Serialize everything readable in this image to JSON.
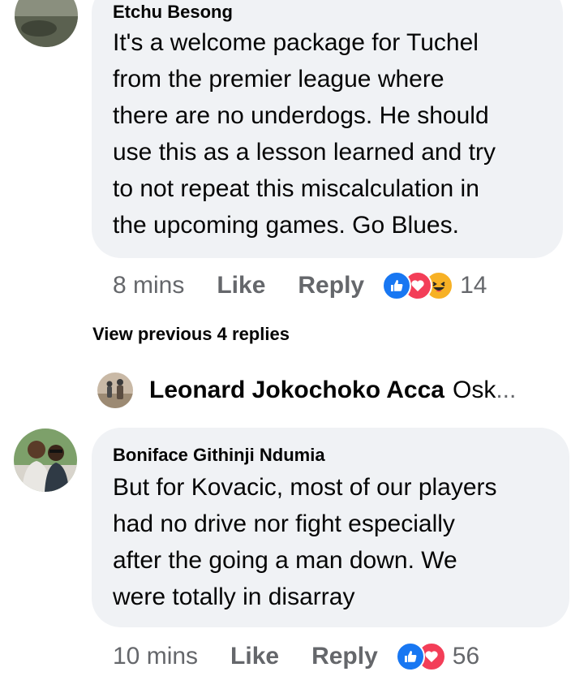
{
  "comment1": {
    "author": "Etchu Besong",
    "lines": [
      "It's a welcome package for Tuchel",
      "from the premier league where",
      "there are no underdogs. He should",
      "use this as a lesson learned and try",
      "to not repeat this miscalculation in",
      "the upcoming games. Go Blues."
    ],
    "time": "8 mins",
    "like_label": "Like",
    "reply_label": "Reply",
    "reaction_count": "14",
    "reactions": [
      "like-icon",
      "love-icon",
      "haha-icon"
    ]
  },
  "view_previous": "View previous 4 replies",
  "reply_preview": {
    "name": "Leonard Jokochoko Acca",
    "snippet": "Osk",
    "ellipsis": "..."
  },
  "comment2": {
    "author": "Boniface Githinji Ndumia",
    "lines": [
      "But for Kovacic, most of our players",
      "had no drive nor fight especially",
      "after the going a man down. We",
      "were totally in disarray"
    ],
    "time": "10 mins",
    "like_label": "Like",
    "reply_label": "Reply",
    "reaction_count": "56",
    "reactions": [
      "like-icon",
      "love-icon"
    ]
  },
  "colors": {
    "bubble": "#f0f2f5",
    "meta": "#65676b",
    "like_blue": "#1877f2",
    "love_red": "#f33e58",
    "haha_yellow": "#f7b125"
  }
}
